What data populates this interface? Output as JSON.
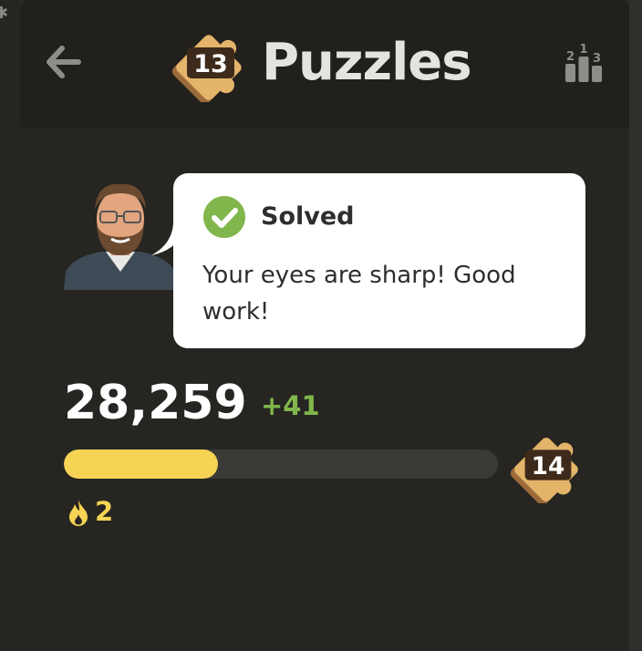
{
  "header": {
    "title": "Puzzles",
    "level_badge": "13",
    "back_icon": "arrow-left-icon",
    "leaderboard_icon": "leaderboard-podium-icon",
    "leaderboard_digits": [
      "2",
      "1",
      "3"
    ]
  },
  "feedback": {
    "status": "Solved",
    "status_icon": "check-circle-icon",
    "message": "Your eyes are sharp! Good work!"
  },
  "stats": {
    "rating": "28,259",
    "delta": "+41",
    "progress_fraction": 0.355,
    "next_level_badge": "14",
    "streak_icon": "flame-icon",
    "streak": "2"
  },
  "colors": {
    "background": "#262522",
    "header": "#21201d",
    "accent_green": "#81b64c",
    "progress_yellow": "#f7d354",
    "bubble": "#ffffff"
  }
}
